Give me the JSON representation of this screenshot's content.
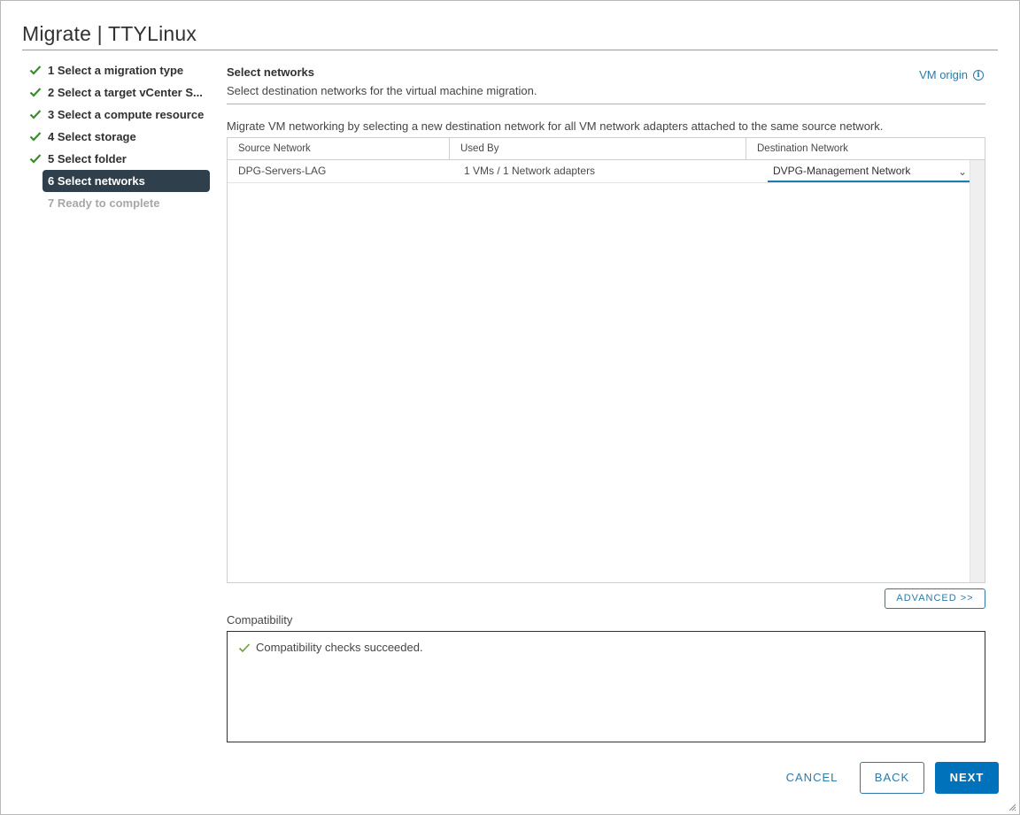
{
  "dialog": {
    "title": "Migrate | TTYLinux"
  },
  "steps": [
    {
      "label": "1 Select a migration type",
      "state": "done"
    },
    {
      "label": "2 Select a target vCenter S...",
      "state": "done"
    },
    {
      "label": "3 Select a compute resource",
      "state": "done"
    },
    {
      "label": "4 Select storage",
      "state": "done"
    },
    {
      "label": "5 Select folder",
      "state": "done"
    },
    {
      "label": "6 Select networks",
      "state": "active"
    },
    {
      "label": "7 Ready to complete",
      "state": "disabled"
    }
  ],
  "section": {
    "title": "Select networks",
    "description": "Select destination networks for the virtual machine migration.",
    "vm_origin": "VM origin",
    "instruction": "Migrate VM networking by selecting a new destination network for all VM network adapters attached to the same source network."
  },
  "grid": {
    "columns": [
      "Source Network",
      "Used By",
      "Destination Network"
    ],
    "rows": [
      {
        "source": "DPG-Servers-LAG",
        "used_by": "1 VMs / 1 Network adapters",
        "destination": "DVPG-Management Network"
      }
    ]
  },
  "advanced_label": "ADVANCED >>",
  "compatibility": {
    "label": "Compatibility",
    "message": "Compatibility checks succeeded."
  },
  "footer": {
    "cancel": "CANCEL",
    "back": "BACK",
    "next": "NEXT"
  },
  "colors": {
    "accent": "#0072bb",
    "link": "#2b7aa9",
    "check": "#3c8c2f",
    "active_step_bg": "#2f3f4c"
  }
}
